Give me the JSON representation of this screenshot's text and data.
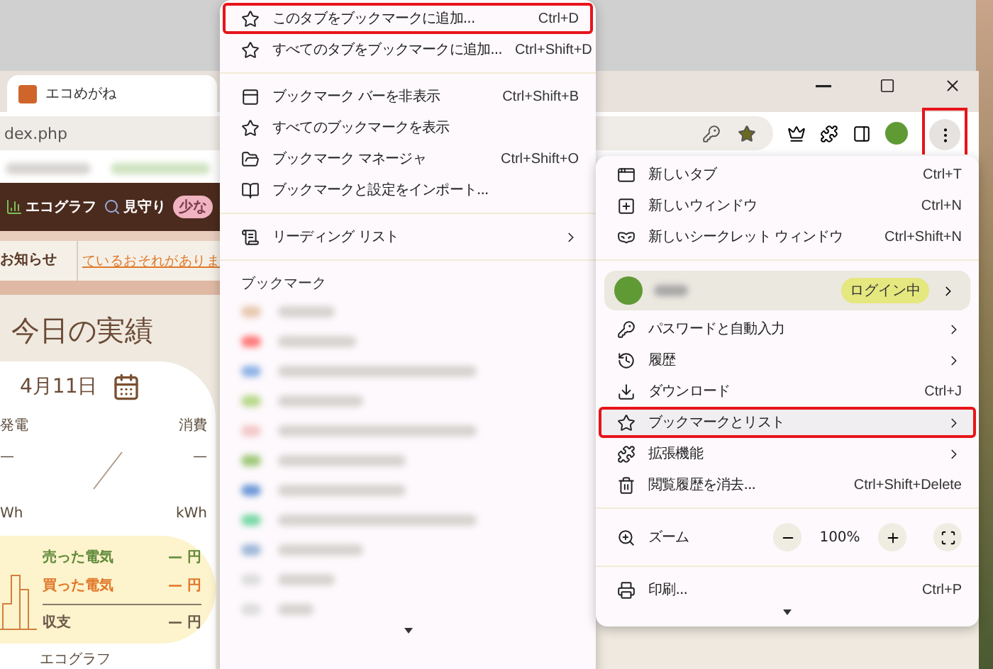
{
  "browser": {
    "tab": {
      "title": "エコめがね"
    },
    "address": "dex.php",
    "menu_button_marked": true
  },
  "page": {
    "nav": [
      {
        "label": "エコグラフ"
      },
      {
        "label": "見守り"
      }
    ],
    "nav_badge": "少な",
    "notice_label": "お知らせ",
    "notice_link": "ているおそれがありま",
    "heading": "今日の実績",
    "date": "4月11日",
    "generation": {
      "label": "発電",
      "value": "—",
      "unit": "Wh"
    },
    "consumption": {
      "label": "消費",
      "value": "—",
      "unit": "kWh"
    },
    "balance": [
      {
        "label": "売った電気",
        "value": "—",
        "unit": "円",
        "color": "#5f8a3a"
      },
      {
        "label": "買った電気",
        "value": "—",
        "unit": "円",
        "color": "#e0782a"
      },
      {
        "label": "収支",
        "value": "—",
        "unit": "円",
        "color": "#6b5a4a"
      }
    ],
    "footer_link": "エコグラフ"
  },
  "submenu": {
    "groups": [
      {
        "items": [
          {
            "label": "このタブをブックマークに追加...",
            "shortcut": "Ctrl+D",
            "marked": true
          },
          {
            "label": "すべてのタブをブックマークに追加...",
            "shortcut": "Ctrl+Shift+D",
            "marked": false
          }
        ]
      },
      {
        "items": [
          {
            "label": "ブックマーク バーを非表示",
            "shortcut": "Ctrl+Shift+B",
            "marked": false
          },
          {
            "label": "すべてのブックマークを表示",
            "marked": false
          },
          {
            "label": "ブックマーク マネージャ",
            "shortcut": "Ctrl+Shift+O",
            "marked": false
          },
          {
            "label": "ブックマークと設定をインポート...",
            "marked": false
          }
        ]
      },
      {
        "items": [
          {
            "label": "リーディング リスト",
            "submenu": true,
            "marked": false
          }
        ]
      }
    ],
    "bookmarks_heading": "ブックマーク"
  },
  "menu": {
    "groups": [
      {
        "items": [
          {
            "kind": "item",
            "label": "新しいタブ",
            "shortcut": "Ctrl+T",
            "selected": false,
            "marked": false
          },
          {
            "kind": "item",
            "label": "新しいウィンドウ",
            "shortcut": "Ctrl+N",
            "selected": false,
            "marked": false
          },
          {
            "kind": "item",
            "label": "新しいシークレット ウィンドウ",
            "shortcut": "Ctrl+Shift+N",
            "selected": false,
            "marked": false
          }
        ]
      },
      {
        "items": [
          {
            "kind": "profile",
            "badge": "ログイン中",
            "selected": false,
            "marked": false
          },
          {
            "kind": "item",
            "label": "パスワードと自動入力",
            "submenu": true,
            "selected": false,
            "marked": false
          },
          {
            "kind": "item",
            "label": "履歴",
            "submenu": true,
            "selected": false,
            "marked": false
          },
          {
            "kind": "item",
            "label": "ダウンロード",
            "shortcut": "Ctrl+J",
            "selected": false,
            "marked": false
          },
          {
            "kind": "item",
            "label": "ブックマークとリスト",
            "submenu": true,
            "selected": true,
            "marked": true
          },
          {
            "kind": "item",
            "label": "拡張機能",
            "submenu": true,
            "selected": false,
            "marked": false
          },
          {
            "kind": "item",
            "label": "閲覧履歴を消去...",
            "shortcut": "Ctrl+Shift+Delete",
            "selected": false,
            "marked": false
          }
        ]
      },
      {
        "items": [
          {
            "kind": "zoom",
            "label": "ズーム",
            "value": "100%",
            "selected": false,
            "marked": false
          }
        ]
      },
      {
        "items": [
          {
            "kind": "item",
            "label": "印刷...",
            "shortcut": "Ctrl+P",
            "selected": false,
            "marked": false
          }
        ]
      }
    ]
  }
}
